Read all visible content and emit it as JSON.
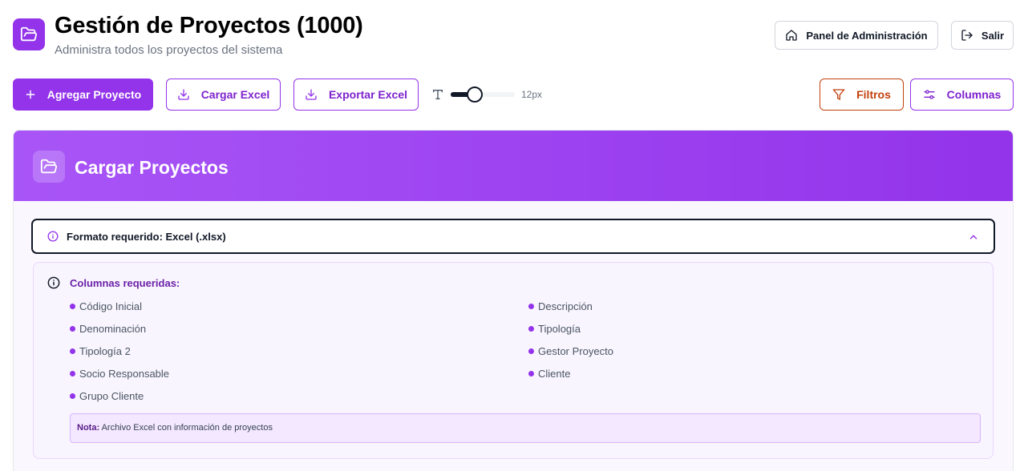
{
  "header": {
    "title": "Gestión de Proyectos (1000)",
    "subtitle": "Administra todos los proyectos del sistema",
    "admin_button": "Panel de Administración",
    "logout_button": "Salir"
  },
  "toolbar": {
    "add_project": "Agregar Proyecto",
    "upload_excel": "Cargar Excel",
    "export_excel": "Exportar Excel",
    "font_size_value": "12px",
    "filters": "Filtros",
    "columns": "Columnas"
  },
  "upload_panel": {
    "title": "Cargar Proyectos",
    "format_label": "Formato requerido: Excel (.xlsx)",
    "required_heading": "Columnas requeridas:",
    "columns_left": [
      "Código Inicial",
      "Denominación",
      "Tipología 2",
      "Socio Responsable",
      "Grupo Cliente"
    ],
    "columns_right": [
      "Descripción",
      "Tipología",
      "Gestor Proyecto",
      "Cliente"
    ],
    "note_label": "Nota:",
    "note_text": "Archivo Excel con información de proyectos"
  },
  "colors": {
    "accent": "#9333ea",
    "accent_dark": "#7e22ce",
    "filter_orange": "#c2410c"
  },
  "icons": [
    "folder-open-icon",
    "home-icon",
    "logout-icon",
    "plus-icon",
    "download-icon",
    "text-size-icon",
    "filter-icon",
    "sliders-icon",
    "info-icon",
    "chevron-up-icon"
  ]
}
